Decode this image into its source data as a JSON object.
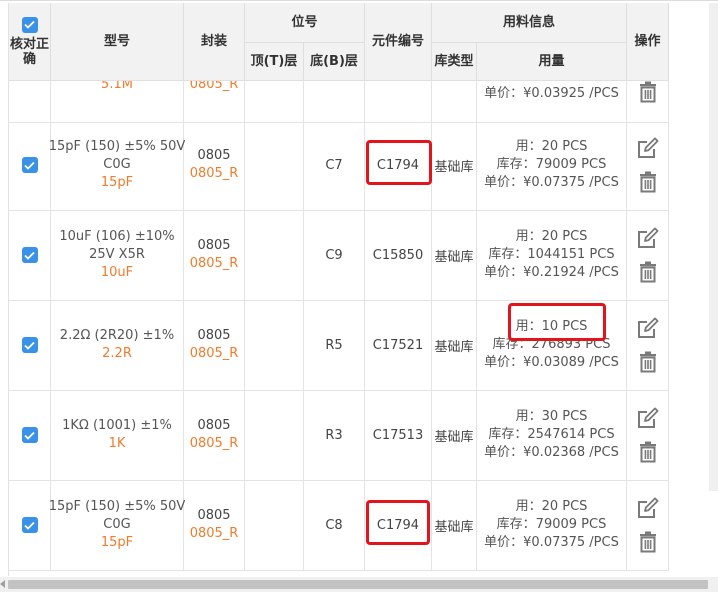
{
  "header": {
    "check_all": "核对正确",
    "model": "型号",
    "package": "封装",
    "position": "位号",
    "top_layer": "顶(T)层",
    "bottom_layer": "底(B)层",
    "part_number": "元件编号",
    "material_info": "用料信息",
    "library_type": "库类型",
    "usage": "用量",
    "actions": "操作"
  },
  "partial_row": {
    "value": "5.1M",
    "package_sub": "0805_R",
    "unit_price": "单价：¥0.03925 /PCS"
  },
  "rows": [
    {
      "model_lines": [
        "15pF (150) ±5% 50V",
        "C0G"
      ],
      "value": "15pF",
      "package": "0805",
      "package_sub": "0805_R",
      "top": "",
      "bottom": "C7",
      "part_number": "C1794",
      "library": "基础库",
      "usage": "用：20 PCS",
      "stock": "库存：79009 PCS",
      "unit_price": "单价：¥0.07375 /PCS"
    },
    {
      "model_lines": [
        "10uF (106) ±10%",
        "25V X5R"
      ],
      "value": "10uF",
      "package": "0805",
      "package_sub": "0805_R",
      "top": "",
      "bottom": "C9",
      "part_number": "C15850",
      "library": "基础库",
      "usage": "用：20 PCS",
      "stock": "库存：1044151 PCS",
      "unit_price": "单价：¥0.21924 /PCS"
    },
    {
      "model_lines": [
        "2.2Ω (2R20) ±1%"
      ],
      "value": "2.2R",
      "package": "0805",
      "package_sub": "0805_R",
      "top": "",
      "bottom": "R5",
      "part_number": "C17521",
      "library": "基础库",
      "usage": "用：10 PCS",
      "stock": "库存：276893 PCS",
      "unit_price": "单价：¥0.03089 /PCS"
    },
    {
      "model_lines": [
        "1KΩ (1001) ±1%"
      ],
      "value": "1K",
      "package": "0805",
      "package_sub": "0805_R",
      "top": "",
      "bottom": "R3",
      "part_number": "C17513",
      "library": "基础库",
      "usage": "用：30 PCS",
      "stock": "库存：2547614 PCS",
      "unit_price": "单价：¥0.02368 /PCS"
    },
    {
      "model_lines": [
        "15pF (150) ±5% 50V",
        "C0G"
      ],
      "value": "15pF",
      "package": "0805",
      "package_sub": "0805_R",
      "top": "",
      "bottom": "C8",
      "part_number": "C1794",
      "library": "基础库",
      "usage": "用：20 PCS",
      "stock": "库存：79009 PCS",
      "unit_price": "单价：¥0.07375 /PCS"
    }
  ],
  "icons": {
    "edit": "edit-icon",
    "delete": "trash-icon",
    "check": "checkmark-icon"
  },
  "colors": {
    "accent": "#3a92e8",
    "value_orange": "#f07c2c",
    "highlight_red": "#e3141b",
    "header_bg": "#f2f2f2"
  }
}
